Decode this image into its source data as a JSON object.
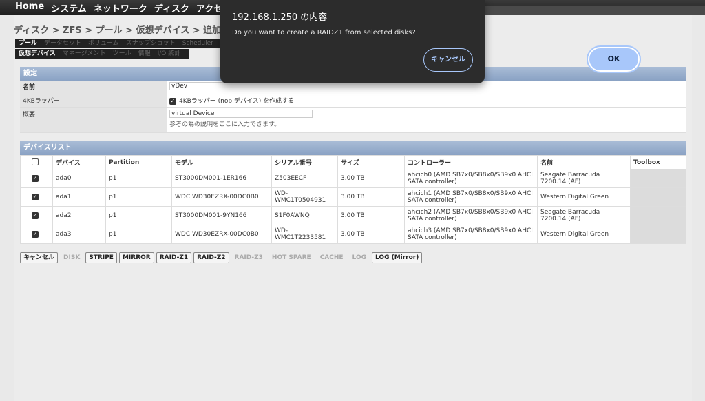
{
  "topnav": {
    "items": [
      "Home",
      "システム",
      "ネットワーク",
      "ディスク",
      "アクセス"
    ]
  },
  "breadcrumb": "ディスク > ZFS > プール > 仮想デバイス > 追加",
  "tabs_row1": [
    "プール",
    "データセット",
    "ボリューム",
    "スナップショット",
    "Scheduler"
  ],
  "tabs_row2": [
    "仮想デバイス",
    "マネージメント",
    "ツール",
    "情報",
    "I/O 統計"
  ],
  "settings": {
    "header": "設定",
    "name_label": "名前",
    "name_value": "vDev",
    "wrapper_label": "4KBラッパー",
    "wrapper_text": "4KBラッパー (nop デバイス) を作成する",
    "desc_label": "概要",
    "desc_value": "virtual Device",
    "desc_note": "参考の為の説明をここに入力できます。"
  },
  "devices": {
    "header": "デバイスリスト",
    "columns": [
      "デバイス",
      "Partition",
      "モデル",
      "シリアル番号",
      "サイズ",
      "コントローラー",
      "名前",
      "Toolbox"
    ],
    "rows": [
      {
        "device": "ada0",
        "partition": "p1",
        "model": "ST3000DM001-1ER166",
        "serial": "Z503EECF",
        "size": "3.00 TB",
        "controller": "ahcich0 (AMD SB7x0/SB8x0/SB9x0 AHCI SATA controller)",
        "name": "Seagate Barracuda 7200.14 (AF)"
      },
      {
        "device": "ada1",
        "partition": "p1",
        "model": "WDC WD30EZRX-00DC0B0",
        "serial": "WD-WMC1T0504931",
        "size": "3.00 TB",
        "controller": "ahcich1 (AMD SB7x0/SB8x0/SB9x0 AHCI SATA controller)",
        "name": "Western Digital Green"
      },
      {
        "device": "ada2",
        "partition": "p1",
        "model": "ST3000DM001-9YN166",
        "serial": "S1F0AWNQ",
        "size": "3.00 TB",
        "controller": "ahcich2 (AMD SB7x0/SB8x0/SB9x0 AHCI SATA controller)",
        "name": "Seagate Barracuda 7200.14 (AF)"
      },
      {
        "device": "ada3",
        "partition": "p1",
        "model": "WDC WD30EZRX-00DC0B0",
        "serial": "WD-WMC1T2233581",
        "size": "3.00 TB",
        "controller": "ahcich3 (AMD SB7x0/SB8x0/SB9x0 AHCI SATA controller)",
        "name": "Western Digital Green"
      }
    ]
  },
  "buttons": {
    "cancel": "キャンセル",
    "disk": "DISK",
    "stripe": "STRIPE",
    "mirror": "MIRROR",
    "raidz1": "RAID-Z1",
    "raidz2": "RAID-Z2",
    "raidz3": "RAID-Z3",
    "hotspare": "HOT SPARE",
    "cache": "CACHE",
    "log": "LOG",
    "logmirror": "LOG (Mirror)"
  },
  "dialog": {
    "title": "192.168.1.250 の内容",
    "message": "Do you want to create a RAIDZ1 from selected disks?",
    "ok": "OK",
    "cancel": "キャンセル"
  }
}
